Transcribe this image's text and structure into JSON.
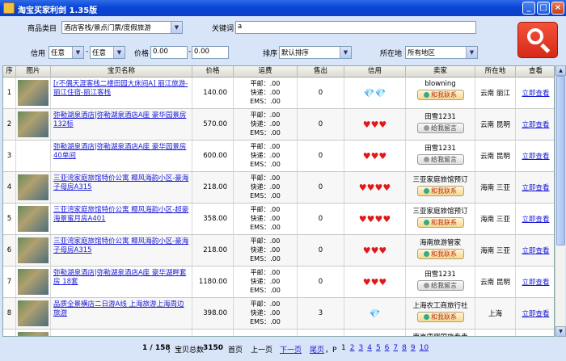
{
  "window": {
    "title": "淘宝买家利剑 1.35版",
    "min": "_",
    "max": "□",
    "close": "×"
  },
  "search": {
    "category_label": "商品类目",
    "category_value": "酒店客栈/景点门票/度假旅游",
    "keyword_label": "关键词",
    "keyword_value": "a",
    "credit_label": "信用",
    "credit_from": "任意",
    "credit_sep": "-",
    "credit_to": "任意",
    "price_label": "价格",
    "price_from": "0.00",
    "price_sep": "-",
    "price_to": "0.00",
    "sort_label": "排序",
    "sort_value": "默认排序",
    "location_label": "所在地",
    "location_value": "所有地区",
    "search_icon": "search-icon"
  },
  "table": {
    "headers": [
      "序",
      "图片",
      "宝贝名称",
      "价格",
      "运费",
      "售出",
      "信用",
      "卖家",
      "所在地",
      "查看"
    ],
    "ship_labels": {
      "ping": "平邮：",
      "kuai": "快递：",
      "ems": "EMS："
    },
    "rows": [
      {
        "idx": "1",
        "name": "[r不偶天涯客栈二楼田园大床间A]  丽江旅游-丽江住宿-丽江客栈",
        "price": "140.00",
        "ship_ping": ".00",
        "ship_kuai": ".00",
        "ship_ems": ".00",
        "sold": "0",
        "credit": "💎💎",
        "credit_type": "diamond",
        "seller": "blowning",
        "contact": "和我联系",
        "contact_style": "online",
        "location": "云南  丽江",
        "view": "立即查看"
      },
      {
        "idx": "2",
        "name": "弥勒湖泉酒店|弥勒湖泉酒店A座  豪华园景房132标",
        "price": "570.00",
        "ship_ping": ".00",
        "ship_kuai": ".00",
        "ship_ems": ".00",
        "sold": "0",
        "credit": "♥♥♥",
        "credit_type": "heart",
        "seller": "田雪1231",
        "contact": "给我留言",
        "contact_style": "offline",
        "location": "云南  昆明",
        "view": "立即查看"
      },
      {
        "idx": "3",
        "name": "弥勒湖泉酒店|弥勒湖泉酒店A座  豪华园景房  40单间",
        "price": "600.00",
        "ship_ping": ".00",
        "ship_kuai": ".00",
        "ship_ems": ".00",
        "sold": "0",
        "credit": "♥♥♥",
        "credit_type": "heart",
        "seller": "田雪1231",
        "contact": "给我留言",
        "contact_style": "offline",
        "location": "云南  昆明",
        "view": "立即查看"
      },
      {
        "idx": "4",
        "name": "三亚湾家庭旅馆特价公寓  椰风海韵小区-豪海子母房A315",
        "price": "218.00",
        "ship_ping": ".00",
        "ship_kuai": ".00",
        "ship_ems": ".00",
        "sold": "0",
        "credit": "♥♥♥♥",
        "credit_type": "heart",
        "seller": "三亚家庭旅馆预订",
        "contact": "和我联系",
        "contact_style": "online",
        "location": "海南  三亚",
        "view": "立即查看"
      },
      {
        "idx": "5",
        "name": "三亚湾家庭旅馆特价公寓  椰风海韵小区-超豪海景蜜月房A401",
        "price": "358.00",
        "ship_ping": ".00",
        "ship_kuai": ".00",
        "ship_ems": ".00",
        "sold": "0",
        "credit": "♥♥♥♥",
        "credit_type": "heart",
        "seller": "三亚家庭旅馆预订",
        "contact": "和我联系",
        "contact_style": "online",
        "location": "海南  三亚",
        "view": "立即查看"
      },
      {
        "idx": "6",
        "name": "三亚湾家庭旅馆特价公寓  椰风海韵小区-豪海子母房A315",
        "price": "218.00",
        "ship_ping": ".00",
        "ship_kuai": ".00",
        "ship_ems": ".00",
        "sold": "0",
        "credit": "♥♥♥",
        "credit_type": "heart",
        "seller": "海南旅游管家",
        "contact": "和我联系",
        "contact_style": "online",
        "location": "海南  三亚",
        "view": "立即查看"
      },
      {
        "idx": "7",
        "name": "弥勒湖泉酒店|弥勒湖泉酒店A座  豪华湖畔套房  18套",
        "price": "1180.00",
        "ship_ping": ".00",
        "ship_kuai": ".00",
        "ship_ems": ".00",
        "sold": "0",
        "credit": "♥♥♥",
        "credit_type": "heart",
        "seller": "田雪1231",
        "contact": "给我留言",
        "contact_style": "offline",
        "location": "云南  昆明",
        "view": "立即查看"
      },
      {
        "idx": "8",
        "name": "品质全景横店二日游A线  上海旅游上海周边旅游",
        "price": "398.00",
        "ship_ping": ".00",
        "ship_kuai": ".00",
        "ship_ems": ".00",
        "sold": "3",
        "credit": "💎",
        "credit_type": "diamond",
        "seller": "上海农工商旅行社",
        "contact": "和我联系",
        "contact_style": "online",
        "location": "上海",
        "view": "立即查看"
      },
      {
        "idx": "",
        "name": "",
        "price": "",
        "ship_ping": "",
        "ship_kuai": "",
        "ship_ems": "",
        "sold": "",
        "credit": "",
        "credit_type": "",
        "seller": "南京康辉国旅专卖",
        "contact": "",
        "contact_style": "",
        "location": "",
        "view": ""
      }
    ]
  },
  "pager": {
    "position": "1 / 158",
    "total_label": "，宝贝总数",
    "total": "3150",
    "first": "首页",
    "prev": "上一页",
    "next": "下一页",
    "last": "尾页",
    "p_label": "，P",
    "pages": [
      "1",
      "2",
      "3",
      "4",
      "5",
      "6",
      "7",
      "8",
      "9",
      "10"
    ]
  }
}
